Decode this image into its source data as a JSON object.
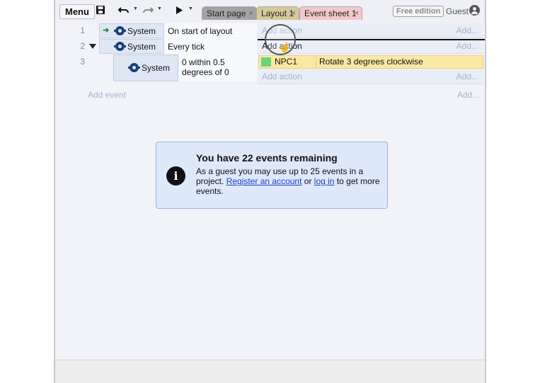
{
  "toolbar": {
    "menu_label": "Menu",
    "tabs": [
      {
        "label": "Start page",
        "close": "×"
      },
      {
        "label": "Layout 1",
        "close": "×"
      },
      {
        "label": "Event sheet 1",
        "close": "×"
      }
    ],
    "edition_badge": "Free edition",
    "user_label": "Guest"
  },
  "icons": {
    "save": "save-icon",
    "undo": "undo-icon",
    "redo": "redo-icon",
    "play": "play-icon",
    "user": "user-icon",
    "system": "gear-icon",
    "info": "info-icon"
  },
  "events": [
    {
      "number": "1",
      "object": "System",
      "condition": "On start of layout",
      "action_placeholder": "Add action",
      "add_right": "Add..."
    },
    {
      "number": "2",
      "object": "System",
      "condition": "Every tick",
      "action_placeholder": "Add action",
      "add_right": "Add..."
    },
    {
      "number": "3",
      "object": "System",
      "condition": "0 within 0.5 degrees of 0",
      "action_object": "NPC1",
      "action_text": "Rotate 3 degrees clockwise",
      "action_placeholder": "Add action",
      "add_right": "Add..."
    }
  ],
  "sheet": {
    "add_event": "Add event",
    "add_event_right": "Add..."
  },
  "notice": {
    "title": "You have 22 events remaining",
    "body_prefix": "As a guest you may use up to 25 events in a project.",
    "register_link": "Register an account",
    "middle": "or",
    "login_link": "log in",
    "body_suffix": "to get more events."
  },
  "colors": {
    "action_highlight": "#fbe8a3",
    "link": "#1a3fc4",
    "notice_bg": "#dde8fa"
  }
}
